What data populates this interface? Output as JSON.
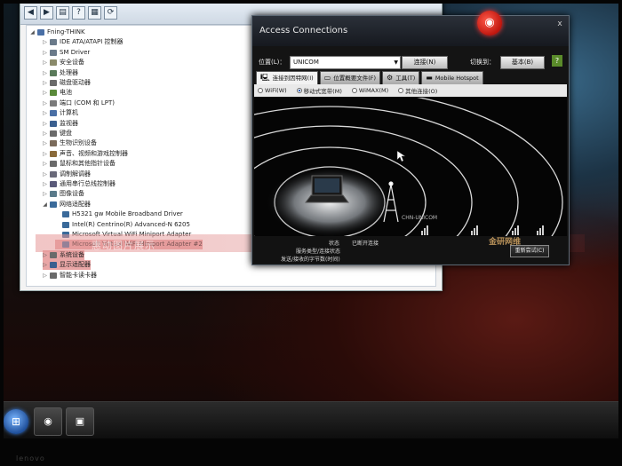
{
  "device_manager": {
    "toolbar_icons": [
      "back-icon",
      "forward-icon",
      "properties-icon",
      "help-icon",
      "scan-icon",
      "update-icon"
    ],
    "rows": [
      {
        "label": "Fning-THINK",
        "indent": 0,
        "expanded": true,
        "icon_color": "#4a6fa5"
      },
      {
        "label": "IDE ATA/ATAPI 控制器",
        "indent": 1,
        "icon_color": "#6a7a8a"
      },
      {
        "label": "SM Driver",
        "indent": 1,
        "icon_color": "#6a7a8a"
      },
      {
        "label": "安全设备",
        "indent": 1,
        "icon_color": "#8a8a6a"
      },
      {
        "label": "处理器",
        "indent": 1,
        "icon_color": "#5a7a5a"
      },
      {
        "label": "磁盘驱动器",
        "indent": 1,
        "icon_color": "#6a6a6a"
      },
      {
        "label": "电池",
        "indent": 1,
        "icon_color": "#5a8a3a"
      },
      {
        "label": "端口 (COM 和 LPT)",
        "indent": 1,
        "icon_color": "#7a7a7a"
      },
      {
        "label": "计算机",
        "indent": 1,
        "icon_color": "#4a6fa5"
      },
      {
        "label": "监视器",
        "indent": 1,
        "icon_color": "#3a5f8f"
      },
      {
        "label": "键盘",
        "indent": 1,
        "icon_color": "#6a6a6a"
      },
      {
        "label": "生物识别设备",
        "indent": 1,
        "icon_color": "#7a6a5a"
      },
      {
        "label": "声音、视频和游戏控制器",
        "indent": 1,
        "icon_color": "#8a6a3a"
      },
      {
        "label": "鼠标和其他指针设备",
        "indent": 1,
        "icon_color": "#6a6a6a"
      },
      {
        "label": "调制解调器",
        "indent": 1,
        "icon_color": "#6a6a7a"
      },
      {
        "label": "通用串行总线控制器",
        "indent": 1,
        "icon_color": "#5a5a7a"
      },
      {
        "label": "图像设备",
        "indent": 1,
        "icon_color": "#5a7a8a"
      },
      {
        "label": "网络适配器",
        "indent": 1,
        "expanded": true,
        "icon_color": "#3a6a9a"
      },
      {
        "label": "H5321 gw Mobile Broadband Driver",
        "indent": 2,
        "icon_color": "#3a6a9a"
      },
      {
        "label": "Intel(R) Centrino(R) Advanced-N 6205",
        "indent": 2,
        "icon_color": "#3a6a9a"
      },
      {
        "label": "Microsoft Virtual WiFi Miniport Adapter",
        "indent": 2,
        "icon_color": "#3a6a9a"
      },
      {
        "label": "Microsoft Virtual WiFi Miniport Adapter #2",
        "indent": 2,
        "icon_color": "#3a6a9a",
        "highlight": true
      },
      {
        "label": "系统设备",
        "indent": 1,
        "icon_color": "#6a6a6a",
        "highlight": true
      },
      {
        "label": "显示适配器",
        "indent": 1,
        "icon_color": "#3a5f8f",
        "highlight": true
      },
      {
        "label": "智能卡读卡器",
        "indent": 1,
        "icon_color": "#6a6a6a"
      }
    ]
  },
  "access_connections": {
    "title": "Access Connections",
    "close_glyph": "x",
    "location_label": "位置(L)：",
    "location_value": "UNICOM",
    "connect_button": "连接(N)",
    "switch_label": "切换到：",
    "switch_button": "基本(B)",
    "tabs": [
      {
        "label": "连接到因特网(I)",
        "active": true
      },
      {
        "label": "位置概要文件(F)"
      },
      {
        "label": "工具(T)"
      },
      {
        "label": "Mobile Hotspot"
      }
    ],
    "radios": [
      {
        "label": "WiFi(W)",
        "selected": false
      },
      {
        "label": "移动式宽带(M)",
        "selected": true
      },
      {
        "label": "WiMAX(M)",
        "selected": false
      },
      {
        "label": "其他连接(O)",
        "selected": false
      }
    ],
    "tower_label": "CHN-UNICOM",
    "status_label": "状态",
    "status_value": "已断开连接",
    "service_label": "服务类型/连接状态",
    "traffic_label": "发送/接收的字节数(时间)",
    "reconnect_button": "重新尝试(C)"
  },
  "overlay": {
    "watermark_left": "惠动图片展示",
    "watermark_right": "金研网维"
  },
  "taskbar": {
    "start_glyph": "⊞",
    "apps": [
      "access-connections-app",
      "media-app"
    ]
  },
  "brand": "lenovo"
}
